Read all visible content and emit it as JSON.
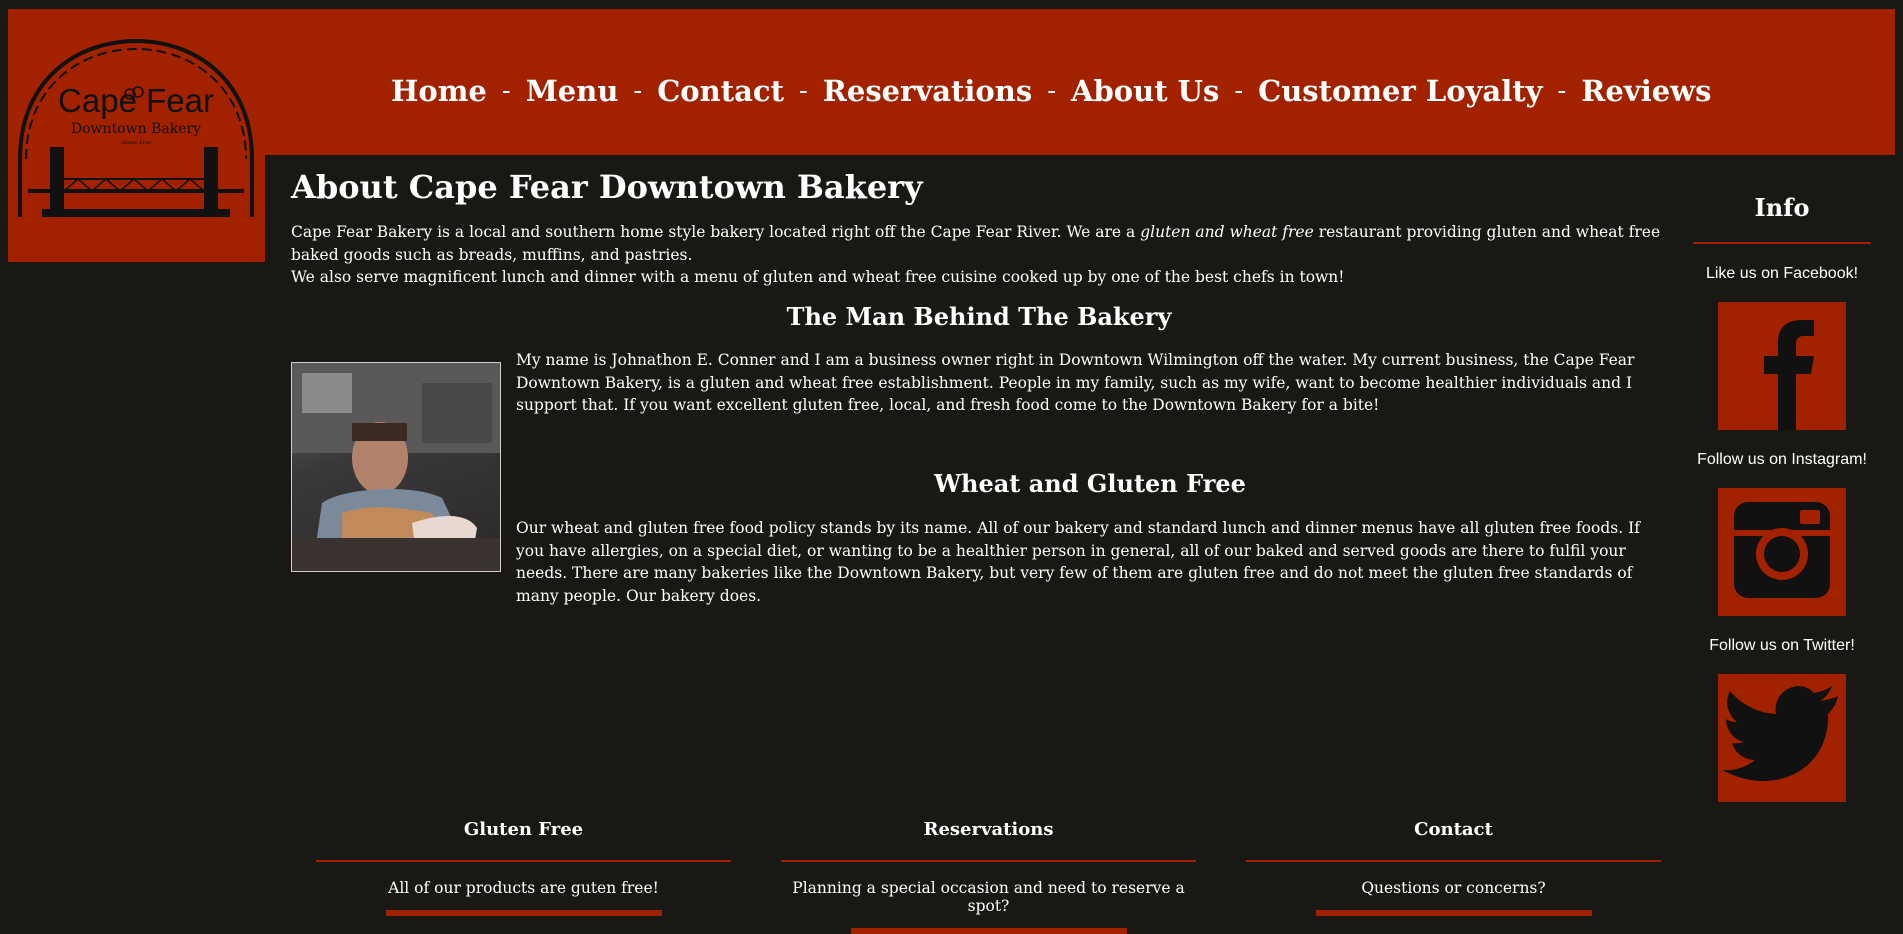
{
  "logo": {
    "line1": "Cape Fear",
    "line2": "Downtown Bakery",
    "line3": "Gluten Free"
  },
  "nav": {
    "items": [
      "Home",
      "Menu",
      "Contact",
      "Reservations",
      "About Us",
      "Customer Loyalty",
      "Reviews"
    ],
    "separator": "-"
  },
  "main": {
    "title": "About Cape Fear Downtown Bakery",
    "intro_pre": "Cape Fear Bakery is a local and southern home style bakery located right off the Cape Fear River. We are a ",
    "intro_em": "gluten and wheat free",
    "intro_post": " restaurant providing gluten and wheat free baked goods such as breads, muffins, and pastries.",
    "intro_2": "We also serve magnificent lunch and dinner with a menu of gluten and wheat free cuisine cooked up by one of the best chefs in town!",
    "man_title": "The Man Behind The Bakery",
    "bio": "My name is Johnathon E. Conner and I am a business owner right in Downtown Wilmington off the water. My current business, the Cape Fear Downtown Bakery, is a gluten and wheat free establishment. People in my family, such as my wife, want to become healthier individuals and I support that. If you want excellent gluten free, local, and fresh food come to the Downtown Bakery for a bite!",
    "wheat_title": "Wheat and Gluten Free",
    "wheat_text": "Our wheat and gluten free food policy stands by its name. All of our bakery and standard lunch and dinner menus have all gluten free foods. If you have allergies, on a special diet, or wanting to be a healthier person in general, all of our baked and served goods are there to fulfil your needs. There are many bakeries like the Downtown Bakery, but very few of them are gluten free and do not meet the gluten free standards of many people. Our bakery does."
  },
  "sidebar": {
    "title": "Info",
    "facebook_label": "Like us on Facebook!",
    "instagram_label": "Follow us on Instagram!",
    "twitter_label": "Follow us on Twitter!"
  },
  "footer": [
    {
      "title": "Gluten Free",
      "text": "All of our products are guten free!"
    },
    {
      "title": "Reservations",
      "text": "Planning a special occasion and need to reserve a spot?"
    },
    {
      "title": "Contact",
      "text": "Questions or concerns?"
    }
  ],
  "colors": {
    "accent": "#a22200",
    "background": "#1a1814",
    "text": "#ffffff"
  }
}
